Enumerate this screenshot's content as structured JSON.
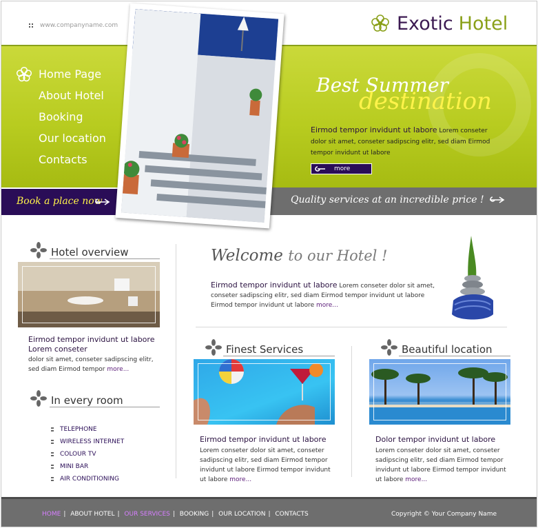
{
  "header": {
    "site_url": "www.companyname.com",
    "logo_word1": "Exotic",
    "logo_word2": "Hotel"
  },
  "nav": {
    "items": [
      "Home Page",
      "About Hotel",
      "Booking",
      "Our location",
      "Contacts"
    ]
  },
  "hero": {
    "title_line1": "Best Summer",
    "title_line2": "destination",
    "lead": "Eirmod tempor invidunt ut labore",
    "text": "Lorem conseter dolor sit amet, conseter sadipscing elitr, sed diam Eirmod tempor invidunt ut labore",
    "more_label": "more"
  },
  "book_bar": {
    "label": "Book a place now"
  },
  "quality_bar": {
    "label": "Quality services at an incredible price !"
  },
  "overview": {
    "heading": "Hotel overview",
    "lead_line1": "Eirmod tempor invidunt ut labore",
    "lead_line2": "Lorem conseter",
    "text": "dolor sit amet, conseter sadipscing elitr, sed diam Eirmod tempor",
    "more": "more..."
  },
  "room": {
    "heading": "In every room",
    "items": [
      "TELEPHONE",
      "WIRELESS INTERNET",
      "COLOUR TV",
      "MINI BAR",
      "AIR CONDITIONING"
    ]
  },
  "welcome": {
    "title_part1": "Welcome",
    "title_part2": "to our Hotel !",
    "lead": "Eirmod tempor invidunt ut labore",
    "text": "Lorem conseter dolor sit amet, conseter sadipscing elitr, sed diam Eirmod tempor invidunt ut labore Eirmod tempor invidunt ut labore",
    "more": "more..."
  },
  "services": {
    "heading": "Finest Services",
    "lead": "Eirmod tempor invidunt ut labore",
    "text": "Lorem conseter dolor sit amet, conseter sadipscing elitr, sed diam Eirmod tempor invidunt ut labore Eirmod tempor invidunt ut labore",
    "more": "more..."
  },
  "location": {
    "heading": "Beautiful location",
    "lead": "Dolor tempor invidunt ut labore",
    "text": "Lorem conseter dolor sit amet, conseter sadipscing elitr, sed diam Eirmod tempor invidunt ut labore Eirmod tempor invidunt ut labore",
    "more": "more..."
  },
  "footer": {
    "nav": [
      "HOME",
      "ABOUT HOTEL",
      "OUR SERVICES",
      "BOOKING",
      "OUR LOCATION",
      "CONTACTS"
    ],
    "copyright": "Copyright © Your Company Name"
  },
  "colors": {
    "brand_purple": "#2a0d57",
    "brand_green": "#b8cc20",
    "accent_yellow": "#fff34a",
    "footer_gray": "#6e6e6e",
    "active_link": "#d77fff"
  },
  "icons": {
    "logo": "flower-icon",
    "nav_home": "flower-icon",
    "section": "flower-icon",
    "hero_more": "swirl-arrow-icon",
    "book": "swirl-arrow-icon",
    "list_bullet": "dots-bullet-icon"
  }
}
